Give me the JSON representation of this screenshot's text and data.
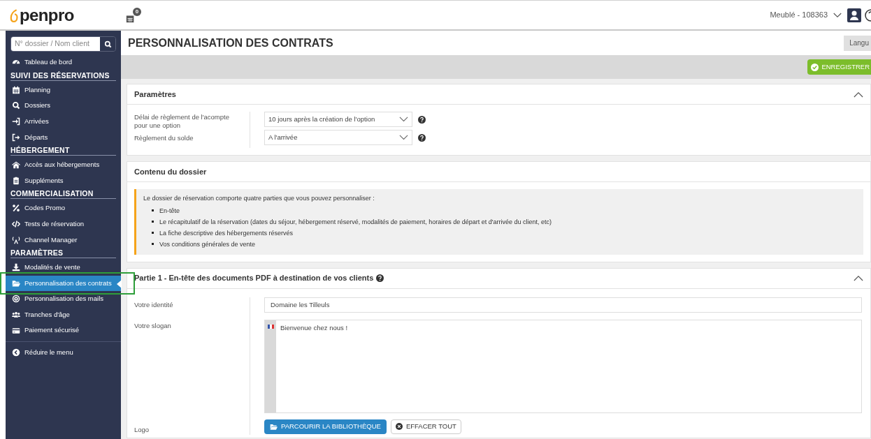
{
  "header": {
    "logo": "penpro",
    "notification_count": "0",
    "account": "Meublé - 108363"
  },
  "sidebar": {
    "search_placeholder": "N° dossier / Nom client",
    "items": [
      {
        "kind": "item",
        "label": "Tableau de bord",
        "selected": false,
        "highlighted": false
      },
      {
        "kind": "heading",
        "label": "SUIVI DES RÉSERVATIONS"
      },
      {
        "kind": "item",
        "label": "Planning",
        "selected": false,
        "highlighted": false
      },
      {
        "kind": "item",
        "label": "Dossiers",
        "selected": false,
        "highlighted": false
      },
      {
        "kind": "item",
        "label": "Arrivées",
        "selected": false,
        "highlighted": false
      },
      {
        "kind": "item",
        "label": "Départs",
        "selected": false,
        "highlighted": false
      },
      {
        "kind": "heading",
        "label": "HÉBERGEMENT"
      },
      {
        "kind": "item",
        "label": "Accès aux hébergements",
        "selected": false,
        "highlighted": false
      },
      {
        "kind": "item",
        "label": "Suppléments",
        "selected": false,
        "highlighted": false
      },
      {
        "kind": "heading",
        "label": "COMMERCIALISATION"
      },
      {
        "kind": "item",
        "label": "Codes Promo",
        "selected": false,
        "highlighted": false
      },
      {
        "kind": "item",
        "label": "Tests de réservation",
        "selected": false,
        "highlighted": false
      },
      {
        "kind": "item",
        "label": "Channel Manager",
        "selected": false,
        "highlighted": false
      },
      {
        "kind": "heading",
        "label": "PARAMÈTRES"
      },
      {
        "kind": "item",
        "label": "Modalités de vente",
        "selected": false,
        "highlighted": false
      },
      {
        "kind": "item",
        "label": "Personnalisation des contrats",
        "selected": true,
        "highlighted": true
      },
      {
        "kind": "item",
        "label": "Personnalisation des mails",
        "selected": false,
        "highlighted": false
      },
      {
        "kind": "item",
        "label": "Tranches d'âge",
        "selected": false,
        "highlighted": false
      },
      {
        "kind": "item",
        "label": "Paiement sécurisé",
        "selected": false,
        "highlighted": false
      },
      {
        "kind": "divider"
      },
      {
        "kind": "item",
        "label": "Réduire le menu",
        "selected": false,
        "highlighted": false
      }
    ]
  },
  "page": {
    "title": "PERSONNALISATION DES CONTRATS",
    "language_button": "Langu",
    "save_button": "ENREGISTRER"
  },
  "parametres": {
    "title": "Paramètres",
    "expanded": true,
    "rows": [
      {
        "label": "Délai de règlement de l'acompte pour une option",
        "value": "10 jours après la création de l'option"
      },
      {
        "label": "Règlement du solde",
        "value": "A l'arrivée"
      }
    ]
  },
  "contenu": {
    "title": "Contenu du dossier",
    "intro": "Le dossier de réservation comporte quatre parties que vous pouvez personnaliser :",
    "bullets": [
      "En-tête",
      "Le récapitulatif de la réservation (dates du séjour, hébergement réservé, modalités de paiement, horaires de départ et d'arrivée du client, etc)",
      "La fiche descriptive des hébergements réservés",
      "Vos conditions générales de vente"
    ]
  },
  "partie1": {
    "title": "Partie 1 - En-tête des documents PDF à destination de vos clients",
    "expanded": true,
    "identity_label": "Votre identité",
    "identity_value": "Domaine les Tilleuls",
    "slogan_label": "Votre slogan",
    "slogan_value": "Bienvenue chez nous !",
    "logo_label": "Logo",
    "browse_button": "PARCOURIR LA BIBLIOTHÈQUE",
    "clear_button": "EFFACER TOUT"
  }
}
